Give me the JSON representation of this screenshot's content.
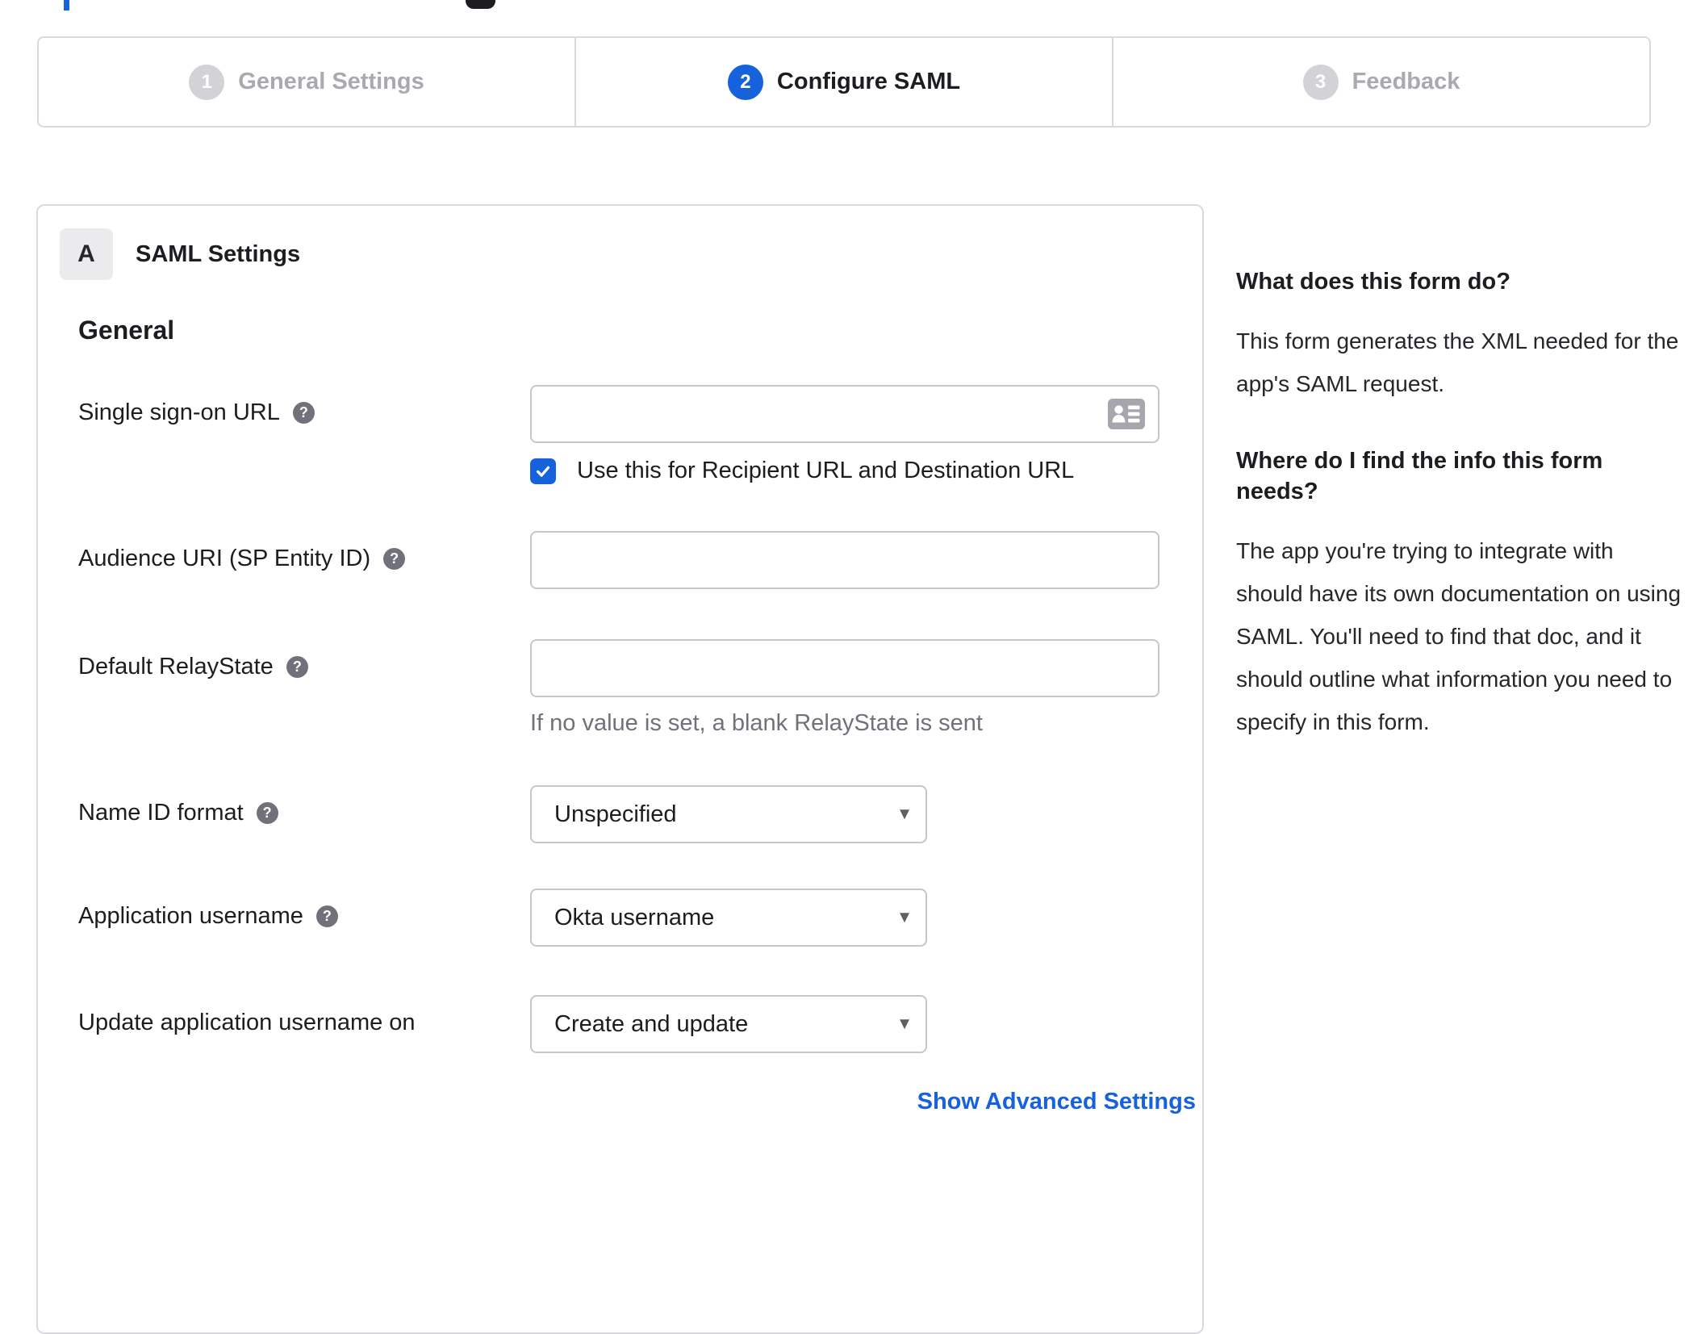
{
  "icons": {
    "help_glyph": "?",
    "caret_glyph": "▾"
  },
  "colors": {
    "accent_blue": "#1662dd",
    "inactive_gray": "#a9a9b0",
    "border_gray": "#dadade"
  },
  "stepper": {
    "steps": [
      {
        "number": "1",
        "label": "General Settings",
        "state": "inactive"
      },
      {
        "number": "2",
        "label": "Configure SAML",
        "state": "active"
      },
      {
        "number": "3",
        "label": "Feedback",
        "state": "inactive"
      }
    ]
  },
  "panel": {
    "badge": "A",
    "title": "SAML Settings",
    "section_heading": "General",
    "fields": [
      {
        "label": "Single sign-on URL",
        "value": "",
        "checkbox_label": "Use this for Recipient URL and Destination URL",
        "checkbox_checked": true
      },
      {
        "label": "Audience URI (SP Entity ID)",
        "value": ""
      },
      {
        "label": "Default RelayState",
        "value": "",
        "hint": "If no value is set, a blank RelayState is sent"
      },
      {
        "label": "Name ID format",
        "value": "Unspecified"
      },
      {
        "label": "Application username",
        "value": "Okta username"
      },
      {
        "label": "Update application username on",
        "value": "Create and update"
      }
    ],
    "advanced_link": "Show Advanced Settings"
  },
  "sidebar": {
    "block1_heading": "What does this form do?",
    "block1_body": "This form generates the XML needed for the app's SAML request.",
    "block2_heading": "Where do I find the info this form needs?",
    "block2_body": "The app you're trying to integrate with should have its own documentation on using SAML. You'll need to find that doc, and it should outline what information you need to specify in this form."
  }
}
